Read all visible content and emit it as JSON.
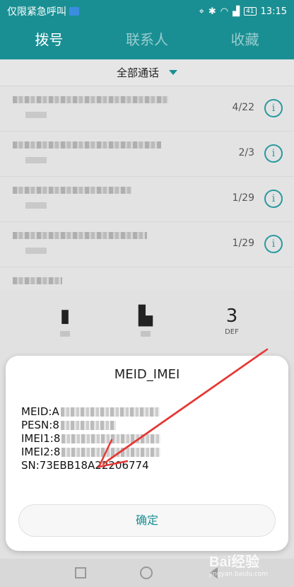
{
  "status_bar": {
    "carrier_text": "仅限紧急呼叫",
    "battery": "41",
    "time": "13:15"
  },
  "tabs": [
    {
      "label": "拨号",
      "active": true
    },
    {
      "label": "联系人",
      "active": false
    },
    {
      "label": "收藏",
      "active": false
    }
  ],
  "call_filter": {
    "label": "全部通话"
  },
  "call_log": [
    {
      "date": "4/22"
    },
    {
      "date": "2/3"
    },
    {
      "date": "1/29"
    },
    {
      "date": "1/29"
    }
  ],
  "dialpad": {
    "key_3": {
      "digit": "3",
      "letters": "DEF"
    }
  },
  "dialog": {
    "title": "MEID_IMEI",
    "lines": {
      "meid": "MEID:A",
      "pesn": "PESN:8",
      "imei1": "IMEI1:8",
      "imei2": "IMEI2:8",
      "sn": "SN:73EBB18A22206774"
    },
    "confirm_label": "确定"
  },
  "watermark": {
    "logo": "Bai经验",
    "url": "jingyan.baidu.com"
  },
  "colors": {
    "accent": "#1a8f93",
    "arrow": "#e53935"
  }
}
